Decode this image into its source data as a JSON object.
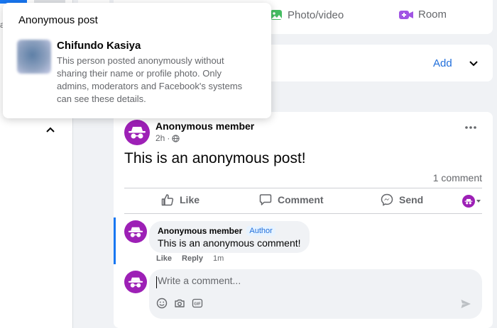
{
  "left_sidebar": {
    "cut_letter": "a"
  },
  "composer": {
    "photo_video_label": "Photo/video",
    "room_label": "Room",
    "photo_icon": "photo-icon",
    "room_icon": "video-room-icon",
    "colors": {
      "photo": "#45bd62",
      "room": "#a155e4"
    }
  },
  "add_card": {
    "add_label": "Add"
  },
  "popup": {
    "title": "Anonymous post",
    "name": "Chifundo Kasiya",
    "description": "This person posted anonymously without sharing their name or profile photo. Only admins, moderators and Facebook's systems can see these details."
  },
  "post": {
    "author": "Anonymous member",
    "time": "2h",
    "privacy_icon": "globe-icon",
    "text": "This is an anonymous post!",
    "comment_count": "1 comment",
    "actions": {
      "like": "Like",
      "comment": "Comment",
      "send": "Send"
    }
  },
  "comment": {
    "author": "Anonymous member",
    "badge": "Author",
    "text": "This is an anonymous comment!",
    "like": "Like",
    "reply": "Reply",
    "time": "1m"
  },
  "write_comment": {
    "placeholder": "Write a comment..."
  },
  "colors": {
    "accent": "#1877f2",
    "avatar": "#9d20b6",
    "link": "#216fdb"
  }
}
